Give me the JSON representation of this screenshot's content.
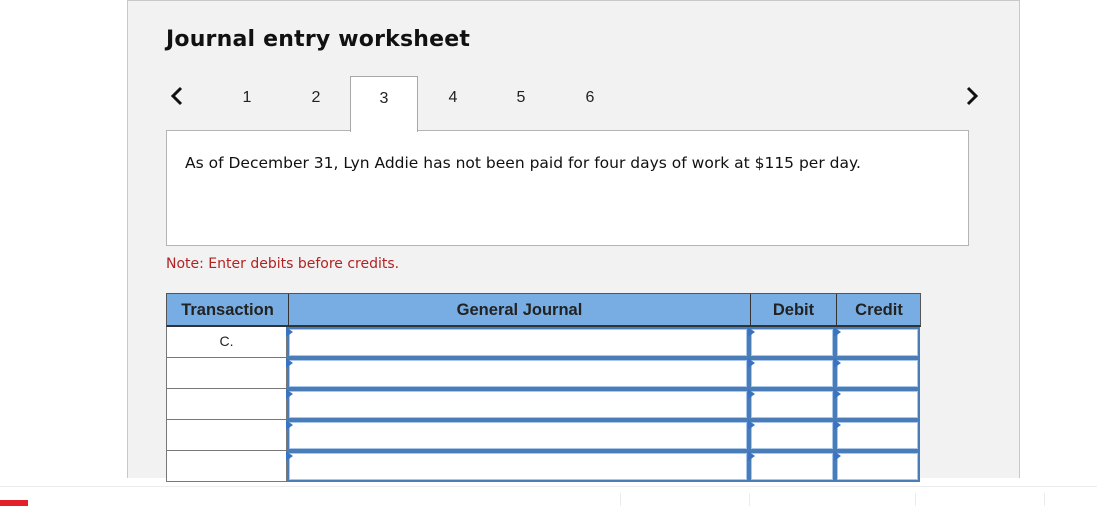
{
  "worksheet": {
    "title": "Journal entry worksheet",
    "nav": {
      "prev_icon": "chevron-left-icon",
      "next_icon": "chevron-right-icon"
    },
    "tabs": [
      {
        "label": "1",
        "active": false
      },
      {
        "label": "2",
        "active": false
      },
      {
        "label": "3",
        "active": true
      },
      {
        "label": "4",
        "active": false
      },
      {
        "label": "5",
        "active": false
      },
      {
        "label": "6",
        "active": false
      }
    ],
    "description": "As of December 31, Lyn Addie has not been paid for four days of work at $115 per day.",
    "note": "Note: Enter debits before credits."
  },
  "journal": {
    "headers": {
      "transaction": "Transaction",
      "general_journal": "General Journal",
      "debit": "Debit",
      "credit": "Credit"
    },
    "rows": [
      {
        "transaction": "C.",
        "account": "",
        "debit": "",
        "credit": ""
      },
      {
        "transaction": "",
        "account": "",
        "debit": "",
        "credit": ""
      },
      {
        "transaction": "",
        "account": "",
        "debit": "",
        "credit": ""
      },
      {
        "transaction": "",
        "account": "",
        "debit": "",
        "credit": ""
      },
      {
        "transaction": "",
        "account": "",
        "debit": "",
        "credit": ""
      }
    ]
  },
  "colors": {
    "panel_bg": "#f2f2f2",
    "header_bg": "#78ade3",
    "input_border": "#4a7db8",
    "note_text": "#b22222",
    "footer_accent": "#e3202a"
  }
}
